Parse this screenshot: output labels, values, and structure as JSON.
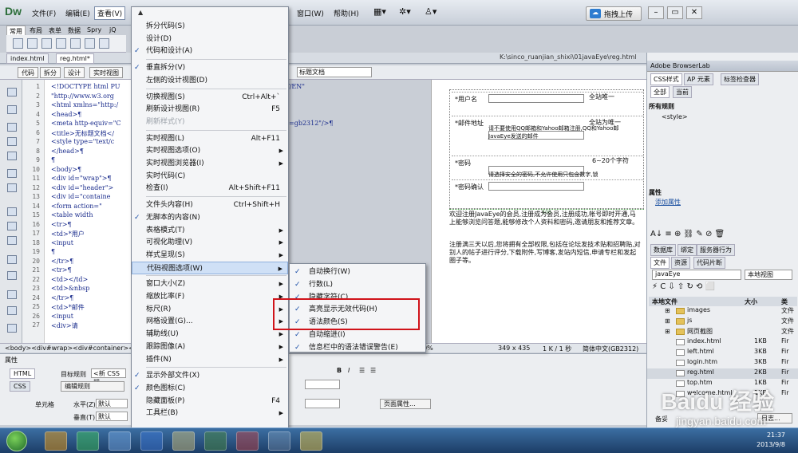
{
  "app": {
    "logo": "Dw"
  },
  "menubar": [
    "文件(F)",
    "编辑(E)",
    "查看(V)",
    "窗口(W)",
    "帮助(H)"
  ],
  "sync_button": "拖拽上传",
  "insert_tabs": [
    "常用",
    "布局",
    "表单",
    "数据",
    "Spry",
    "jQ"
  ],
  "doc_tabs": [
    "index.html",
    "reg.html*"
  ],
  "doc_path": "K:\\sinco_ruanjian_shixi\\01javaEye\\reg.html",
  "view_buttons": [
    "代码",
    "拆分",
    "设计",
    "实时视图"
  ],
  "title_field": "标题文档",
  "code": {
    "line_numbers": [
      "1",
      "2",
      "3",
      "4",
      "5",
      "6",
      "7",
      "8",
      "9",
      "10",
      "11",
      "12",
      "13",
      "14",
      "15",
      "16",
      "17",
      "18",
      "19",
      "20",
      "21",
      "22",
      "23",
      "24",
      "25",
      "26",
      "27"
    ],
    "lines": [
      "<!DOCTYPE html PU",
      "\"http://www.w3.org",
      "<html xmlns=\"http:/",
      "<head>¶",
      "<meta http-equiv=\"C",
      "<title>无标题文档</",
      "<style type=\"text/c",
      "</head>¶",
      "¶",
      "<body>¶",
      "<div id=\"wrap\">¶",
      " <div id=\"header\">",
      " <div id=\"containe",
      "   <form action=\"",
      "    <table width",
      "      <tr>¶",
      "       <td>*用户",
      "       <input",
      "¶",
      "      </tr>¶",
      "      <tr>¶",
      "       <td></td>",
      "       <td>&nbsp",
      "      </tr>¶",
      "       <td>*邮件",
      "       <input",
      "        <div>请"
    ],
    "end_fragments": [
      "//EN\"",
      "=gb2312\"/>¶"
    ]
  },
  "view_menu": {
    "items": [
      {
        "label": "拆分代码(S)",
        "shortcut": "",
        "checked": false,
        "submenu": false,
        "disabled": false
      },
      {
        "label": "设计(D)",
        "shortcut": "",
        "checked": false,
        "submenu": false,
        "disabled": false
      },
      {
        "label": "代码和设计(A)",
        "shortcut": "",
        "checked": true,
        "submenu": false,
        "disabled": false
      },
      {
        "sep": true
      },
      {
        "label": "垂直拆分(V)",
        "shortcut": "",
        "checked": true,
        "submenu": false,
        "disabled": false
      },
      {
        "label": "左侧的设计视图(D)",
        "shortcut": "",
        "checked": false,
        "submenu": false,
        "disabled": false
      },
      {
        "sep": true
      },
      {
        "label": "切换视图(S)",
        "shortcut": "Ctrl+Alt+`",
        "checked": false,
        "submenu": false,
        "disabled": false
      },
      {
        "label": "刷新设计视图(R)",
        "shortcut": "F5",
        "checked": false,
        "submenu": false,
        "disabled": false
      },
      {
        "label": "刷新样式(Y)",
        "shortcut": "",
        "checked": false,
        "submenu": false,
        "disabled": true
      },
      {
        "sep": true
      },
      {
        "label": "实时视图(L)",
        "shortcut": "Alt+F11",
        "checked": false,
        "submenu": false,
        "disabled": false
      },
      {
        "label": "实时视图选项(O)",
        "shortcut": "",
        "checked": false,
        "submenu": true,
        "disabled": false
      },
      {
        "label": "实时视图浏览器(I)",
        "shortcut": "",
        "checked": false,
        "submenu": true,
        "disabled": false
      },
      {
        "label": "实时代码(C)",
        "shortcut": "",
        "checked": false,
        "submenu": false,
        "disabled": false
      },
      {
        "label": "检查(I)",
        "shortcut": "Alt+Shift+F11",
        "checked": false,
        "submenu": false,
        "disabled": false
      },
      {
        "sep": true
      },
      {
        "label": "文件头内容(H)",
        "shortcut": "Ctrl+Shift+H",
        "checked": false,
        "submenu": false,
        "disabled": false
      },
      {
        "label": "无脚本的内容(N)",
        "shortcut": "",
        "checked": true,
        "submenu": false,
        "disabled": false
      },
      {
        "label": "表格模式(T)",
        "shortcut": "",
        "checked": false,
        "submenu": true,
        "disabled": false
      },
      {
        "label": "可视化助理(V)",
        "shortcut": "",
        "checked": false,
        "submenu": true,
        "disabled": false
      },
      {
        "label": "样式呈现(S)",
        "shortcut": "",
        "checked": false,
        "submenu": true,
        "disabled": false
      },
      {
        "label": "代码视图选项(W)",
        "shortcut": "",
        "checked": false,
        "submenu": true,
        "disabled": false,
        "hover": true
      },
      {
        "sep": true
      },
      {
        "label": "窗口大小(Z)",
        "shortcut": "",
        "checked": false,
        "submenu": true,
        "disabled": false
      },
      {
        "label": "缩放比率(F)",
        "shortcut": "",
        "checked": false,
        "submenu": true,
        "disabled": false
      },
      {
        "label": "标尺(R)",
        "shortcut": "",
        "checked": false,
        "submenu": true,
        "disabled": false
      },
      {
        "label": "网格设置(G)...",
        "shortcut": "",
        "checked": false,
        "submenu": true,
        "disabled": false
      },
      {
        "label": "辅助线(U)",
        "shortcut": "",
        "checked": false,
        "submenu": true,
        "disabled": false
      },
      {
        "label": "跟踪图像(A)",
        "shortcut": "",
        "checked": false,
        "submenu": true,
        "disabled": false
      },
      {
        "label": "插件(N)",
        "shortcut": "",
        "checked": false,
        "submenu": true,
        "disabled": false
      },
      {
        "sep": true
      },
      {
        "label": "显示外部文件(X)",
        "shortcut": "",
        "checked": true,
        "submenu": false,
        "disabled": false
      },
      {
        "label": "颜色图标(C)",
        "shortcut": "",
        "checked": true,
        "submenu": false,
        "disabled": false
      },
      {
        "label": "隐藏面板(P)",
        "shortcut": "F4",
        "checked": false,
        "submenu": false,
        "disabled": false
      },
      {
        "label": "工具栏(B)",
        "shortcut": "",
        "checked": false,
        "submenu": true,
        "disabled": false
      }
    ]
  },
  "code_view_submenu": {
    "items": [
      {
        "label": "自动换行(W)",
        "checked": true
      },
      {
        "label": "行数(L)",
        "checked": true
      },
      {
        "label": "隐藏字符(C)",
        "checked": true
      },
      {
        "label": "高亮显示无效代码(H)",
        "checked": true
      },
      {
        "label": "语法颜色(S)",
        "checked": true
      },
      {
        "label": "自动缩进(I)",
        "checked": true
      },
      {
        "label": "信息栏中的语法错误警告(E)",
        "checked": true
      }
    ]
  },
  "design": {
    "rows": [
      {
        "label": "*用户名",
        "note": "全站唯一"
      },
      {
        "label": "*邮件地址",
        "note": "全站为唯一",
        "desc": "请不要使用QQ邮箱和Yahoo邮箱注册,QQ和Yahoo邮",
        "desc2": "JavaEye发送的邮件"
      },
      {
        "label": "*密码",
        "note": "6~20个字符",
        "desc": "请选择安全的密码,不允许使用只包含数字,锁"
      },
      {
        "label": "*密码确认",
        "note": ""
      }
    ],
    "ruler": "500",
    "paragraphs": [
      "欢迎注册JavaEye的会员,注册成为会员,注册成功,帐号即时开通,马上能够浏览问答题,能够修改个人资料和密码,邀请朋友和推荐文章。",
      "注册满三天以后,您将拥有全部权限,包括在论坛发技术贴和招聘贴,对别人的帖子进行评分,下载附件,写博客,发站内短信,申请专栏和发起圈子等。"
    ]
  },
  "tagbar": {
    "path": "<body><div#wrap><div#container><f",
    "zoom": "0%",
    "size": "349 x 435",
    "speed": "1 K / 1 秒",
    "encoding": "简体中文(GB2312)"
  },
  "properties": {
    "title": "属性",
    "html_button": "HTML",
    "css_button": "CSS",
    "target_rule_label": "目标规则",
    "target_rule_value": "<新 CSS 规",
    "edit_rule": "编辑规则",
    "cell_label": "单元格",
    "horz_label": "水平(Z)",
    "horz_value": "默认",
    "vert_label": "垂直(T)",
    "vert_value": "默认",
    "page_props": "页面属性..."
  },
  "right_panel": {
    "browserlab": "Adobe BrowserLab",
    "css_tabs": [
      "CSS样式",
      "AP 元素",
      "标签检查器"
    ],
    "mode_tabs": [
      "全部",
      "当前"
    ],
    "all_rules": "所有规则",
    "style_rule": "<style>",
    "props_title": "属性",
    "add_prop": "添加属性",
    "file_tabs": [
      "数据库",
      "绑定",
      "服务器行为"
    ],
    "file_tabs2": [
      "文件",
      "资源",
      "代码片断"
    ],
    "site": "javaEye",
    "local_view": "本地视图",
    "file_header": {
      "name": "本地文件",
      "size": "大小",
      "type": "类"
    },
    "files": [
      {
        "name": "images",
        "size": "",
        "type": "文件",
        "kind": "folder"
      },
      {
        "name": "js",
        "size": "",
        "type": "文件",
        "kind": "folder"
      },
      {
        "name": "网页截图",
        "size": "",
        "type": "文件",
        "kind": "folder"
      },
      {
        "name": "index.html",
        "size": "1KB",
        "type": "Fir",
        "kind": "file"
      },
      {
        "name": "left.html",
        "size": "3KB",
        "type": "Fir",
        "kind": "file"
      },
      {
        "name": "login.htm",
        "size": "3KB",
        "type": "Fir",
        "kind": "file"
      },
      {
        "name": "reg.html",
        "size": "2KB",
        "type": "Fir",
        "kind": "file"
      },
      {
        "name": "top.htm",
        "size": "1KB",
        "type": "Fir",
        "kind": "file"
      },
      {
        "name": "welcome.html",
        "size": "1KB",
        "type": "Fir",
        "kind": "file"
      }
    ],
    "ready": "备妥",
    "log": "日志..."
  },
  "taskbar": {
    "time": "21:37",
    "date": "2013/9/8"
  },
  "watermark": {
    "main": "Baidu 经验",
    "url": "jingyan.baidu.com"
  },
  "colors": {
    "accent": "#2d7cd0",
    "highlight": "#d0131a",
    "hover": "#cfe0f6"
  }
}
